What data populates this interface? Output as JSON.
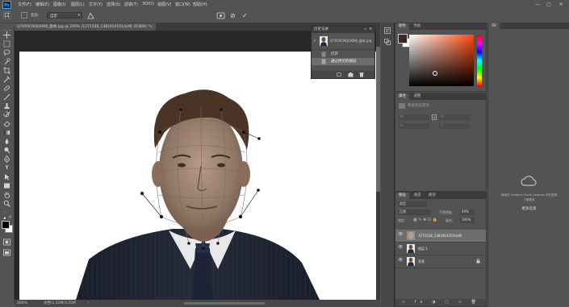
{
  "menubar": {
    "app_logo": "Ps",
    "items": [
      "文件(F)",
      "编辑(E)",
      "图像(I)",
      "图层(L)",
      "文字(Y)",
      "选择(S)",
      "滤镜(T)",
      "3D(D)",
      "视图(V)",
      "窗口(W)",
      "帮助(H)"
    ],
    "win_min": "—",
    "win_max": "▢",
    "win_close": "✕"
  },
  "optbar": {
    "preset_label": "变形:",
    "preset_value": "自定",
    "confirm": "✓",
    "cancel": "⊘"
  },
  "document": {
    "tab_title": "Q7050CNQ04BW_副本.jpg @ 200% (1271528_1381814101dvW, RGB/8) *",
    "tab_close": "×"
  },
  "statusbar": {
    "zoom": "200%",
    "doc_info": "文档:1.52M/3.55M"
  },
  "history": {
    "title": "历史记录",
    "snapshot_name": "Q7050CNQ04BW_副本.jpg",
    "items": [
      "打开",
      "通过拷贝的图层"
    ],
    "active_index": 1
  },
  "color_panel": {
    "tabs": [
      "颜色",
      "色板"
    ],
    "fg_color": "#3a2a22",
    "bg_color": "#ffffff"
  },
  "properties_panel": {
    "tabs": [
      "属性",
      "调整"
    ],
    "section": "像素图层属性",
    "fields": [
      "W:",
      "H:",
      "X:",
      "Y:"
    ]
  },
  "layers_panel": {
    "tabs": [
      "图层",
      "通道",
      "路径"
    ],
    "kind_label": "类型",
    "blend_mode": "正常",
    "opacity_label": "不透明度:",
    "opacity_value": "40%",
    "lock_label": "锁定:",
    "fill_label": "填充:",
    "fill_value": "100%",
    "layers": [
      {
        "name": "1271528_1381814101dvW",
        "selected": true
      },
      {
        "name": "图层 1",
        "selected": false
      },
      {
        "name": "背景",
        "selected": false
      }
    ]
  },
  "libraries_panel": {
    "message": "使用在 Creative Cloud Libraries 中的资源",
    "link": "了解更多",
    "button": "更多信息"
  },
  "tools": [
    "move-tool",
    "marquee-tool",
    "lasso-tool",
    "quick-select-tool",
    "crop-tool",
    "eyedropper-tool",
    "healing-tool",
    "brush-tool",
    "clone-stamp-tool",
    "history-brush-tool",
    "eraser-tool",
    "gradient-tool",
    "blur-tool",
    "dodge-tool",
    "pen-tool",
    "type-tool",
    "path-select-tool",
    "shape-tool",
    "hand-tool",
    "zoom-tool"
  ],
  "colors": {
    "accent": "#31a8ff",
    "panel": "#535353",
    "selection": "#6e6e6e"
  }
}
